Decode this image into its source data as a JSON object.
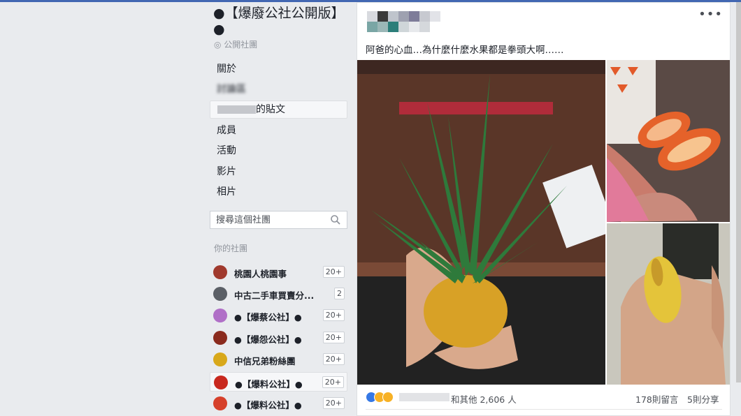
{
  "group": {
    "title": "●【爆廢公社公開版】●",
    "privacy": "公開社團",
    "nav": [
      "關於",
      "討論區",
      "的貼文",
      "成員",
      "活動",
      "影片",
      "相片"
    ]
  },
  "search": {
    "placeholder": "搜尋這個社團"
  },
  "your_groups": {
    "heading": "你的社團",
    "items": [
      {
        "name": "桃園人桃園事",
        "count": "20+",
        "color": "#a0392d"
      },
      {
        "name": "中古二手車買賣分...",
        "count": "2",
        "color": "#5b5f66"
      },
      {
        "name": "●【爆蔡公社】●",
        "count": "20+",
        "color": "#b06fc7"
      },
      {
        "name": "●【爆怨公社】●",
        "count": "20+",
        "color": "#8a2a1d"
      },
      {
        "name": "中信兄弟粉絲團",
        "count": "20+",
        "color": "#d8a81a"
      },
      {
        "name": "●【爆料公社】●",
        "count": "20+",
        "color": "#c8281e"
      },
      {
        "name": "●【爆料公社】●",
        "count": "20+",
        "color": "#d6402a"
      }
    ]
  },
  "post": {
    "text": "阿爸的心血…為什麼什麼水果都是拳頭大啊……",
    "more": "•••",
    "reactions": "和其他 2,606 人",
    "comments": "178則留言",
    "shares": "5則分享"
  },
  "colors": {
    "fb_blue": "#4267b2",
    "like": "#3578e5",
    "haha": "#f7b125"
  }
}
